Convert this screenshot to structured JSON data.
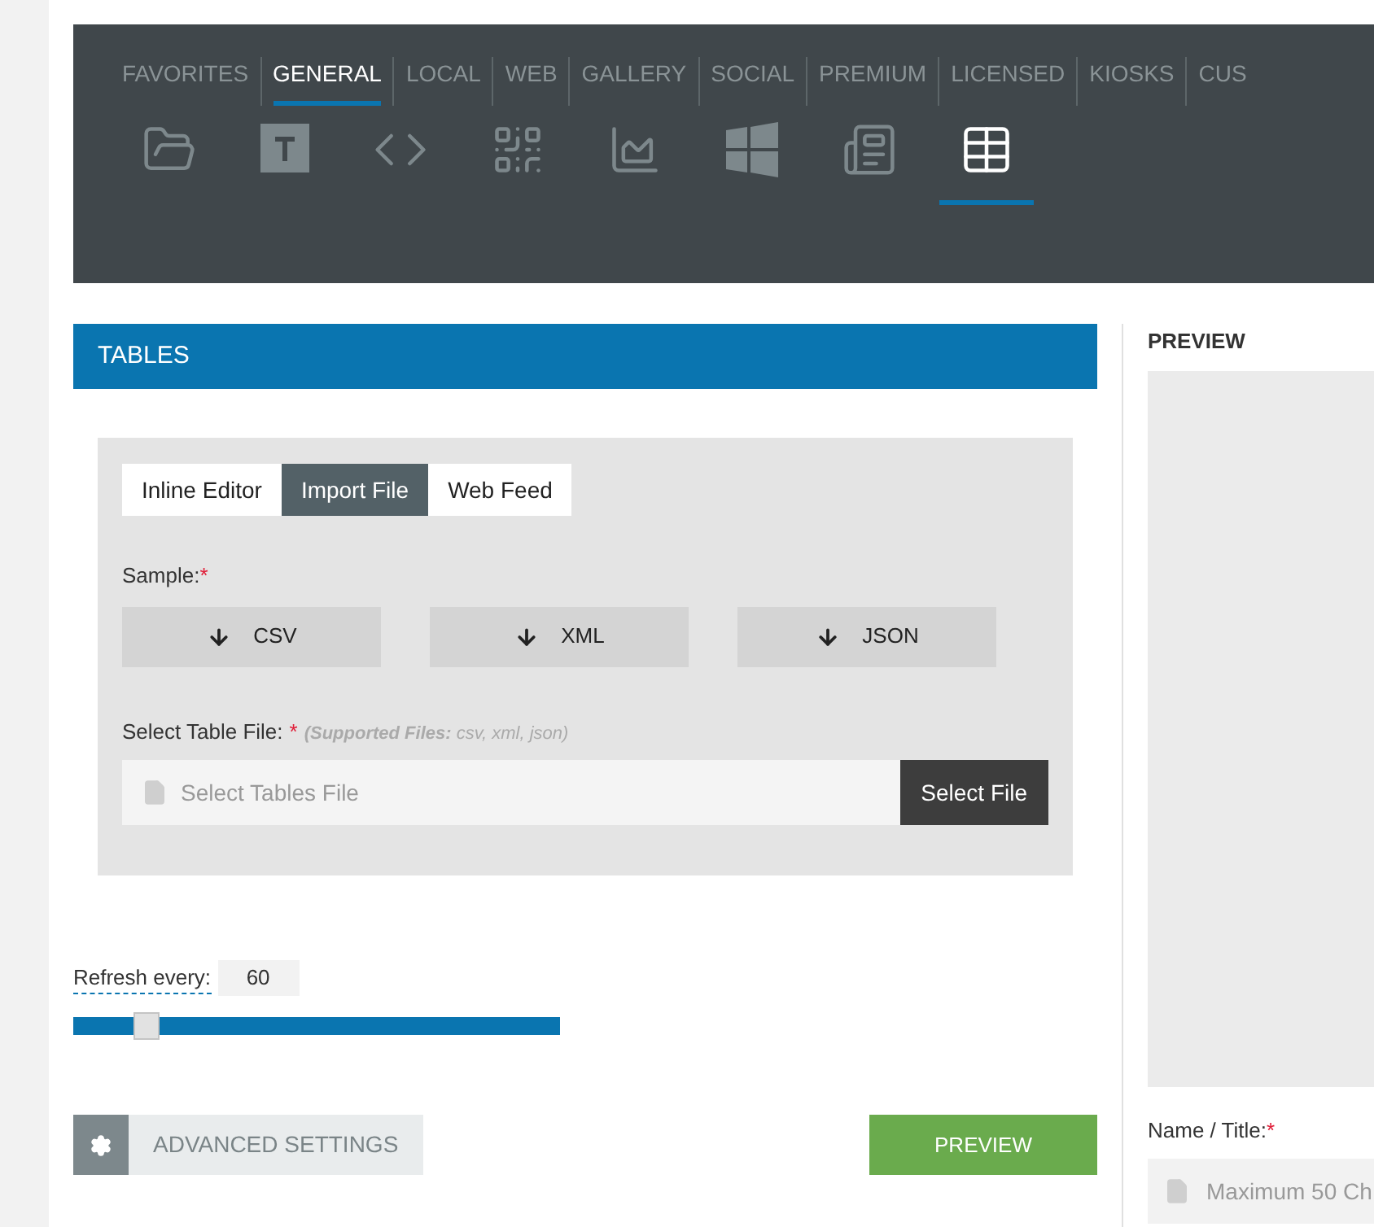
{
  "categories": [
    {
      "label": "FAVORITES",
      "selected": false
    },
    {
      "label": "GENERAL",
      "selected": true
    },
    {
      "label": "LOCAL",
      "selected": false
    },
    {
      "label": "WEB",
      "selected": false
    },
    {
      "label": "GALLERY",
      "selected": false
    },
    {
      "label": "SOCIAL",
      "selected": false
    },
    {
      "label": "PREMIUM",
      "selected": false
    },
    {
      "label": "LICENSED",
      "selected": false
    },
    {
      "label": "KIOSKS",
      "selected": false
    },
    {
      "label": "CUS",
      "selected": false
    }
  ],
  "widgets": [
    {
      "kind": "folder",
      "selected": false
    },
    {
      "kind": "text",
      "selected": false
    },
    {
      "kind": "code",
      "selected": false
    },
    {
      "kind": "qr",
      "selected": false
    },
    {
      "kind": "chart",
      "selected": false
    },
    {
      "kind": "windows",
      "selected": false
    },
    {
      "kind": "news",
      "selected": false
    },
    {
      "kind": "table",
      "selected": true
    }
  ],
  "section_title": "TABLES",
  "source_tabs": [
    {
      "label": "Inline Editor",
      "selected": false
    },
    {
      "label": "Import File",
      "selected": true
    },
    {
      "label": "Web Feed",
      "selected": false
    }
  ],
  "sample": {
    "label": "Sample:",
    "required": "*",
    "buttons": [
      "CSV",
      "XML",
      "JSON"
    ]
  },
  "file": {
    "label": "Select Table File:",
    "required": "*",
    "hint": "**(Supported Files:** csv, xml, json)",
    "placeholder": "Select Tables File",
    "button": "Select File"
  },
  "refresh": {
    "label": "Refresh every:",
    "value": "60",
    "level": 0.15
  },
  "advanced_settings": "ADVANCED SETTINGS",
  "preview_button": "PREVIEW",
  "preview": {
    "title": "PREVIEW",
    "name_label": "Name / Title:",
    "required": "*",
    "name_placeholder": "Maximum 50 Ch"
  }
}
